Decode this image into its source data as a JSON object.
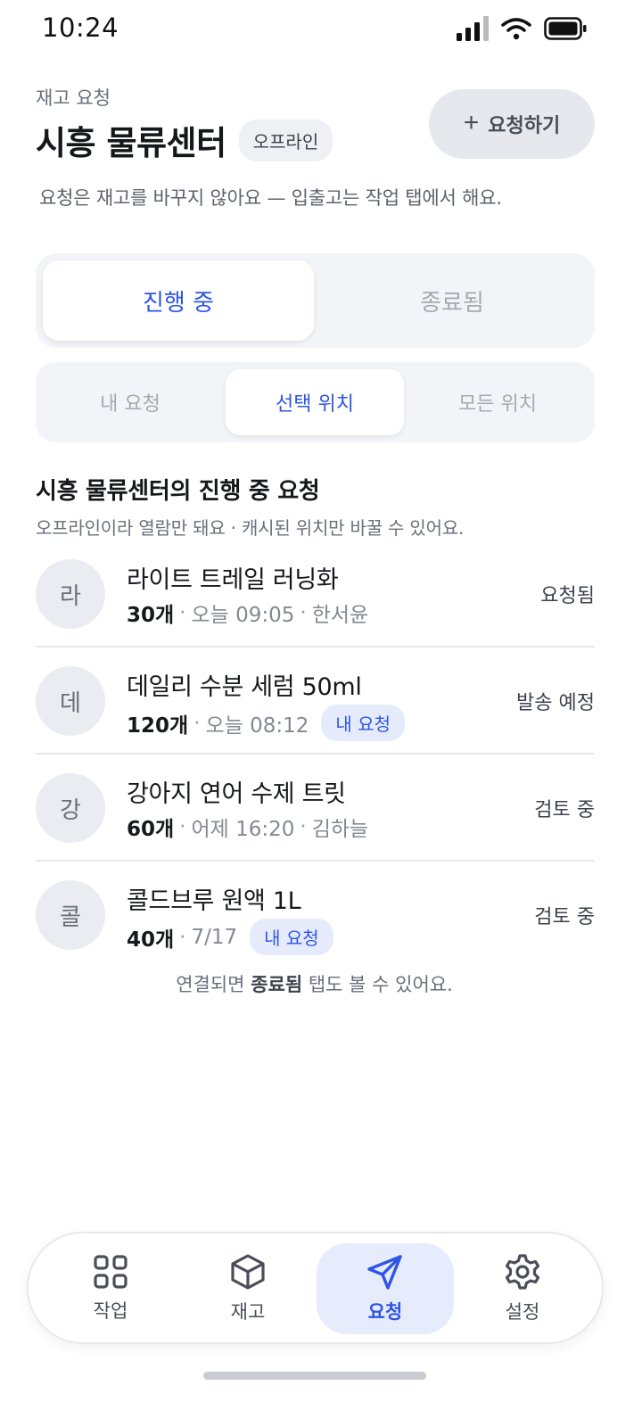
{
  "status_bar": {
    "time": "10:24"
  },
  "header": {
    "eyebrow": "재고 요청",
    "title": "시흥 물류센터",
    "offline_badge": "오프라인",
    "request_button": "요청하기",
    "subtitle": "요청은 재고를 바꾸지 않아요 — 입출고는 작업 탭에서 해요."
  },
  "tabs_status": {
    "active": "진행 중",
    "inactive": "종료됨"
  },
  "tabs_scope": {
    "mine": "내 요청",
    "selected": "선택 위치",
    "all": "모든 위치"
  },
  "section": {
    "title": "시흥 물류센터의 진행 중 요청",
    "subtitle": "오프라인이라 열람만 돼요 · 캐시된 위치만 바꿀 수 있어요."
  },
  "requests": [
    {
      "initial": "라",
      "name": "라이트 트레일 러닝화",
      "qty": "30개",
      "time": "오늘 09:05",
      "requester": "한서윤",
      "status": "요청됨"
    },
    {
      "initial": "데",
      "name": "데일리 수분 세럼 50ml",
      "qty": "120개",
      "time": "오늘 08:12",
      "mine": "내 요청",
      "status": "발송 예정"
    },
    {
      "initial": "강",
      "name": "강아지 연어 수제 트릿",
      "qty": "60개",
      "time": "어제 16:20",
      "requester": "김하늘",
      "status": "검토 중"
    },
    {
      "initial": "콜",
      "name": "콜드브루 원액 1L",
      "qty": "40개",
      "time": "7/17",
      "mine": "내 요청",
      "status": "검토 중"
    }
  ],
  "footer": {
    "prefix": "연결되면 ",
    "bold": "종료됨",
    "suffix": " 탭도 볼 수 있어요."
  },
  "nav": {
    "work": "작업",
    "inventory": "재고",
    "requests": "요청",
    "settings": "설정"
  },
  "colors": {
    "accent": "#2f55e4",
    "accent_bg": "#e7ecfc",
    "surface": "#f3f4f7"
  }
}
